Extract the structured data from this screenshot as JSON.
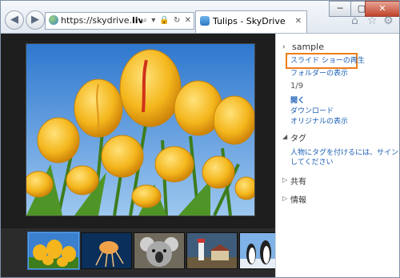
{
  "browser": {
    "address": {
      "url_prefix": "https://skydrive.",
      "url_domain": "live.com",
      "url_suffix": "/",
      "tool_glyphs": "⌕ ▾ 🔒 ↻ ✕"
    },
    "tab": {
      "title": "Tulips - SkyDrive",
      "close_glyph": "✕"
    },
    "window_controls": {
      "minimize": "─",
      "maximize": "▢",
      "close": "✕"
    },
    "back_glyph": "◀",
    "forward_glyph": "▶",
    "toolbar_icons": [
      "home-icon",
      "favorites-star-icon",
      "settings-gear-icon"
    ],
    "toolbar_glyphs": [
      "⌂",
      "☆",
      "⚙"
    ]
  },
  "viewer": {
    "photo_subject": "tulips",
    "thumbnails": [
      "tulips",
      "jellyfish",
      "koala",
      "lighthouse",
      "penguins"
    ],
    "selected_index": 0
  },
  "panel": {
    "folder_name": "sample",
    "slideshow_label": "スライド ショーの再生",
    "show_folder_label": "フォルダーの表示",
    "counter": "1/9",
    "open_label": "開く",
    "download_label": "ダウンロード",
    "original_label": "オリジナルの表示",
    "tags_heading": "タグ",
    "tags_text_1": "人物にタグを付けるには、サインイン",
    "tags_text_2": "してください",
    "share_heading": "共有",
    "info_heading": "情報"
  },
  "colors": {
    "highlight_border": "#ef7c1a",
    "link": "#1b5fb5"
  }
}
